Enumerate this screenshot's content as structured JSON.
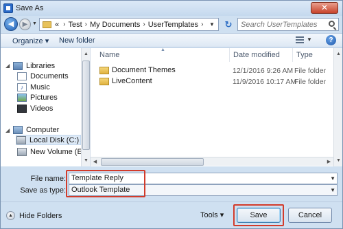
{
  "window": {
    "title": "Save As",
    "close_glyph": "✕"
  },
  "nav": {
    "back_glyph": "◀",
    "forward_glyph": "▶",
    "breadcrumb": [
      "«",
      "Test",
      "My Documents",
      "UserTemplates"
    ],
    "refresh_glyph": "↻"
  },
  "search": {
    "placeholder": "Search UserTemplates"
  },
  "toolbar": {
    "organize_label": "Organize ▾",
    "new_folder_label": "New folder",
    "help_glyph": "?"
  },
  "sidebar": {
    "items": [
      {
        "label": "Libraries",
        "icon": "libraries-icon"
      },
      {
        "label": "Documents",
        "icon": "documents-icon"
      },
      {
        "label": "Music",
        "icon": "music-icon"
      },
      {
        "label": "Pictures",
        "icon": "pictures-icon"
      },
      {
        "label": "Videos",
        "icon": "videos-icon"
      },
      {
        "label": "Computer",
        "icon": "computer-icon"
      },
      {
        "label": "Local Disk (C:)",
        "icon": "disk-icon"
      },
      {
        "label": "New Volume (E:)",
        "icon": "disk-icon"
      }
    ]
  },
  "filelist": {
    "columns": [
      "Name",
      "Date modified",
      "Type"
    ],
    "rows": [
      {
        "name": "Document Themes",
        "date": "12/1/2016 9:26 AM",
        "type": "File folder"
      },
      {
        "name": "LiveContent",
        "date": "11/9/2016 10:17 AM",
        "type": "File folder"
      }
    ]
  },
  "form": {
    "file_name_label": "File name:",
    "file_name_value": "Template Reply",
    "save_type_label": "Save as type:",
    "save_type_value": "Outlook Template"
  },
  "footer": {
    "hide_folders_label": "Hide Folders",
    "tools_label": "Tools ▾",
    "save_label": "Save",
    "cancel_label": "Cancel"
  },
  "colors": {
    "highlight": "#d23b2b",
    "accent": "#2a6ac8"
  }
}
